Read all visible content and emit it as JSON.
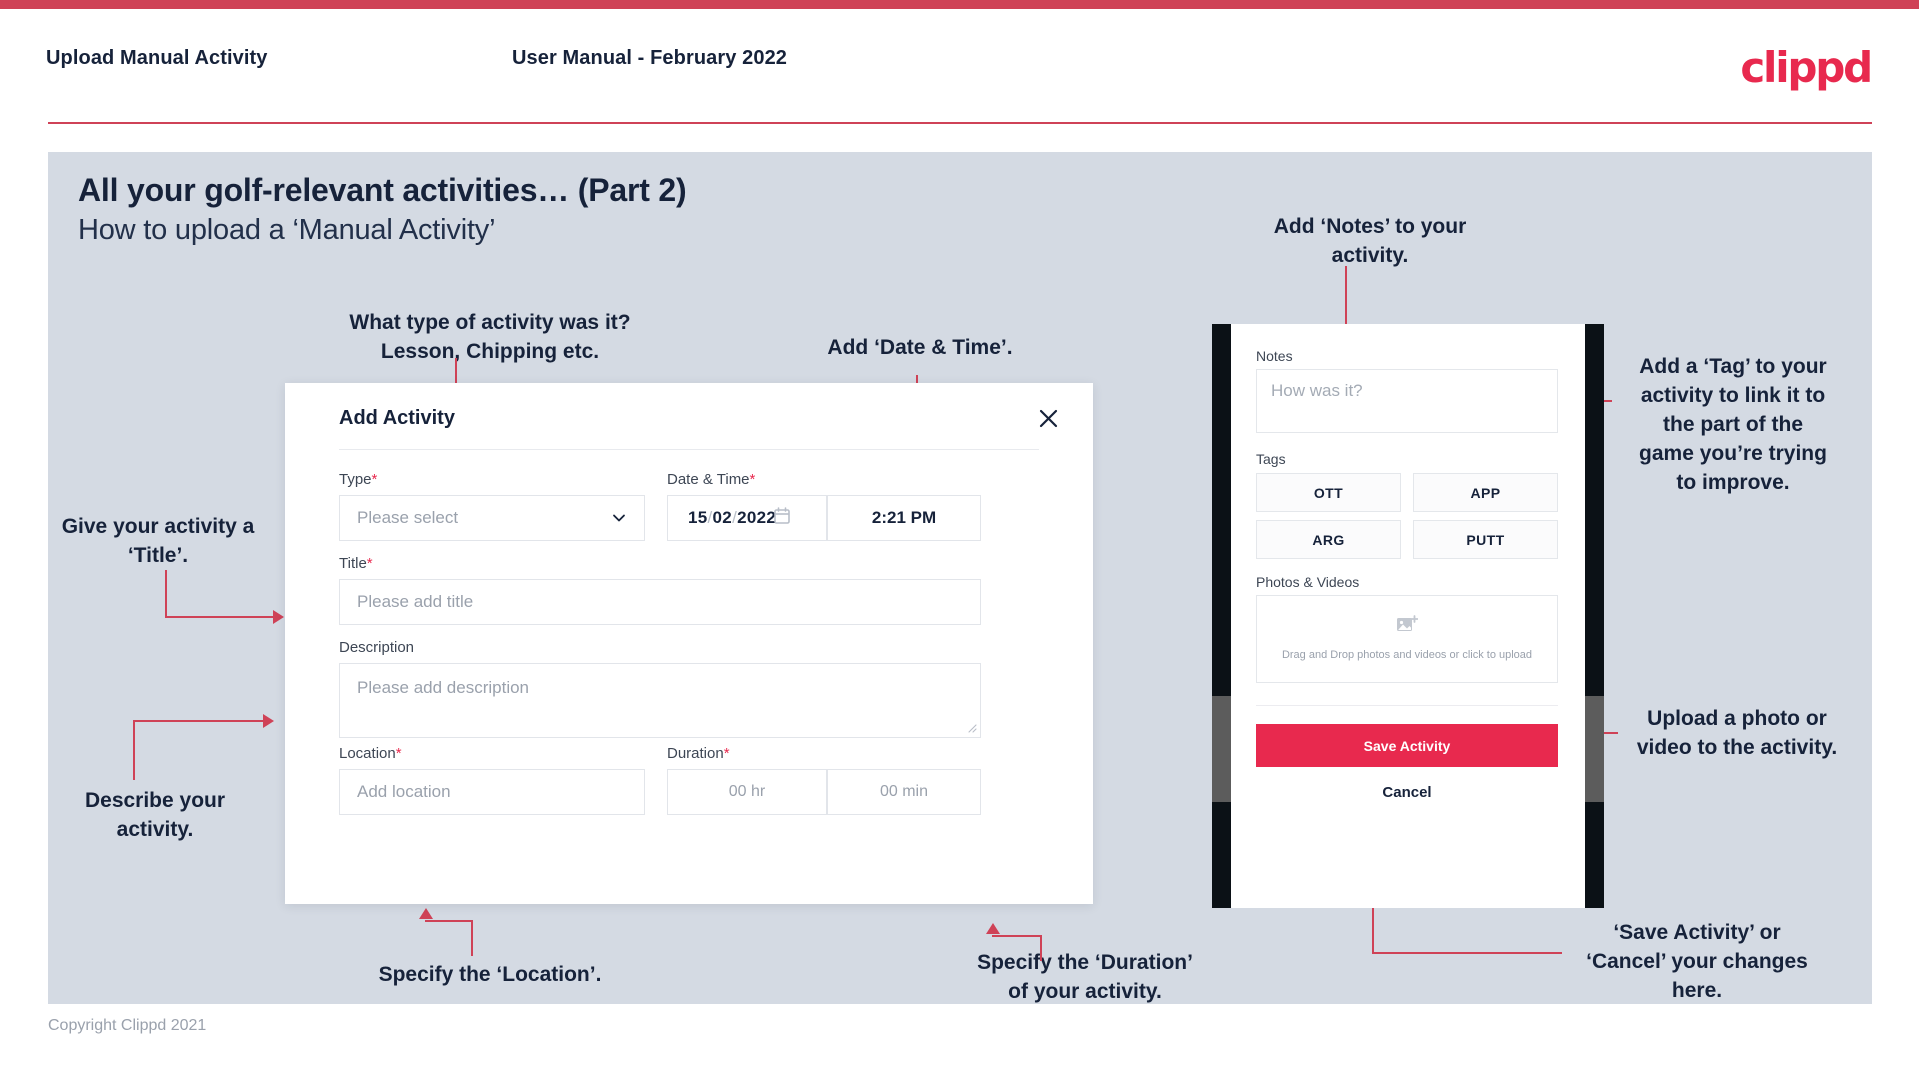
{
  "header": {
    "title": "Upload Manual Activity",
    "subtitle": "User Manual - February 2022",
    "brand": "clippd"
  },
  "slide": {
    "title": "All your golf-relevant activities… (Part 2)",
    "subtitle": "How to upload a ‘Manual Activity’"
  },
  "callouts": {
    "type": "What type of activity was it?\nLesson, Chipping etc.",
    "datetime": "Add ‘Date & Time’.",
    "title": "Give your activity a\n‘Title’.",
    "description": "Describe your\nactivity.",
    "location": "Specify the ‘Location’.",
    "duration": "Specify the ‘Duration’\nof your activity.",
    "notes": "Add ‘Notes’ to your\nactivity.",
    "tag": "Add a ‘Tag’ to your\nactivity to link it to\nthe part of the\ngame you’re trying\nto improve.",
    "upload": "Upload a photo or\nvideo to the activity.",
    "save": "‘Save Activity’ or\n‘Cancel’ your changes\nhere."
  },
  "dialog": {
    "title": "Add Activity",
    "close_icon": "close-icon",
    "fields": {
      "type": {
        "label": "Type",
        "required": "*",
        "placeholder": "Please select",
        "value": ""
      },
      "datetime": {
        "label": "Date & Time",
        "required": "*",
        "day": "15",
        "month": "02",
        "year": "2022",
        "sep": "/",
        "time": "2:21 PM",
        "calendar_icon": "calendar-icon"
      },
      "title": {
        "label": "Title",
        "required": "*",
        "placeholder": "Please add title",
        "value": ""
      },
      "description": {
        "label": "Description",
        "required": "",
        "placeholder": "Please add description",
        "value": ""
      },
      "location": {
        "label": "Location",
        "required": "*",
        "placeholder": "Add location",
        "value": ""
      },
      "duration": {
        "label": "Duration",
        "required": "*",
        "hours_placeholder": "00 hr",
        "minutes_placeholder": "00 min"
      }
    }
  },
  "phone": {
    "notes": {
      "label": "Notes",
      "placeholder": "How was it?",
      "value": ""
    },
    "tags": {
      "label": "Tags",
      "items": [
        "OTT",
        "APP",
        "ARG",
        "PUTT"
      ]
    },
    "media": {
      "label": "Photos & Videos",
      "icon": "add-image-icon",
      "dropzone_text": "Drag and Drop photos and videos or click to upload"
    },
    "save_label": "Save Activity",
    "cancel_label": "Cancel"
  },
  "footer": {
    "copyright": "Copyright Clippd 2021"
  },
  "colors": {
    "accent": "#e8294e",
    "accent_line": "#cf4257",
    "slide_bg": "#d4dae3",
    "text": "#16223a"
  }
}
